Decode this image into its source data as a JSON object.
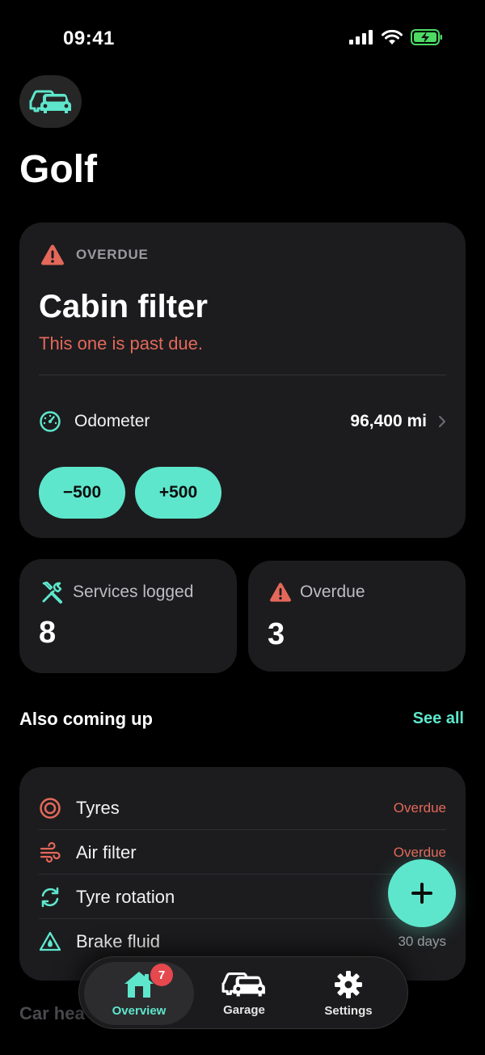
{
  "status_bar": {
    "time": "09:41"
  },
  "header": {
    "title": "Golf",
    "app_icon": "cars-icon"
  },
  "main_card": {
    "badge": "OVERDUE",
    "title": "Cabin filter",
    "subtitle": "This one is past due.",
    "odometer_label": "Odometer",
    "odometer_value": "96,400 mi",
    "decrement_label": "−500",
    "increment_label": "+500"
  },
  "stats": {
    "services_label": "Services logged",
    "services_value": "8",
    "overdue_label": "Overdue",
    "overdue_value": "3"
  },
  "coming_up": {
    "title": "Also coming up",
    "see_all": "See all",
    "items": [
      {
        "label": "Tyres",
        "status": "Overdue",
        "icon": "target-icon"
      },
      {
        "label": "Air filter",
        "status": "Overdue",
        "icon": "wind-icon"
      },
      {
        "label": "Tyre rotation",
        "status": "",
        "icon": "rotate-icon"
      },
      {
        "label": "Brake fluid",
        "status": "30 days",
        "icon": "fluid-warning-icon"
      }
    ]
  },
  "next_section": {
    "title": "Car hea"
  },
  "tabs": {
    "overview": "Overview",
    "overview_badge": "7",
    "garage": "Garage",
    "settings": "Settings"
  },
  "colors": {
    "accent": "#5ee6cc",
    "danger": "#e3685a",
    "card": "#1c1c1e"
  }
}
